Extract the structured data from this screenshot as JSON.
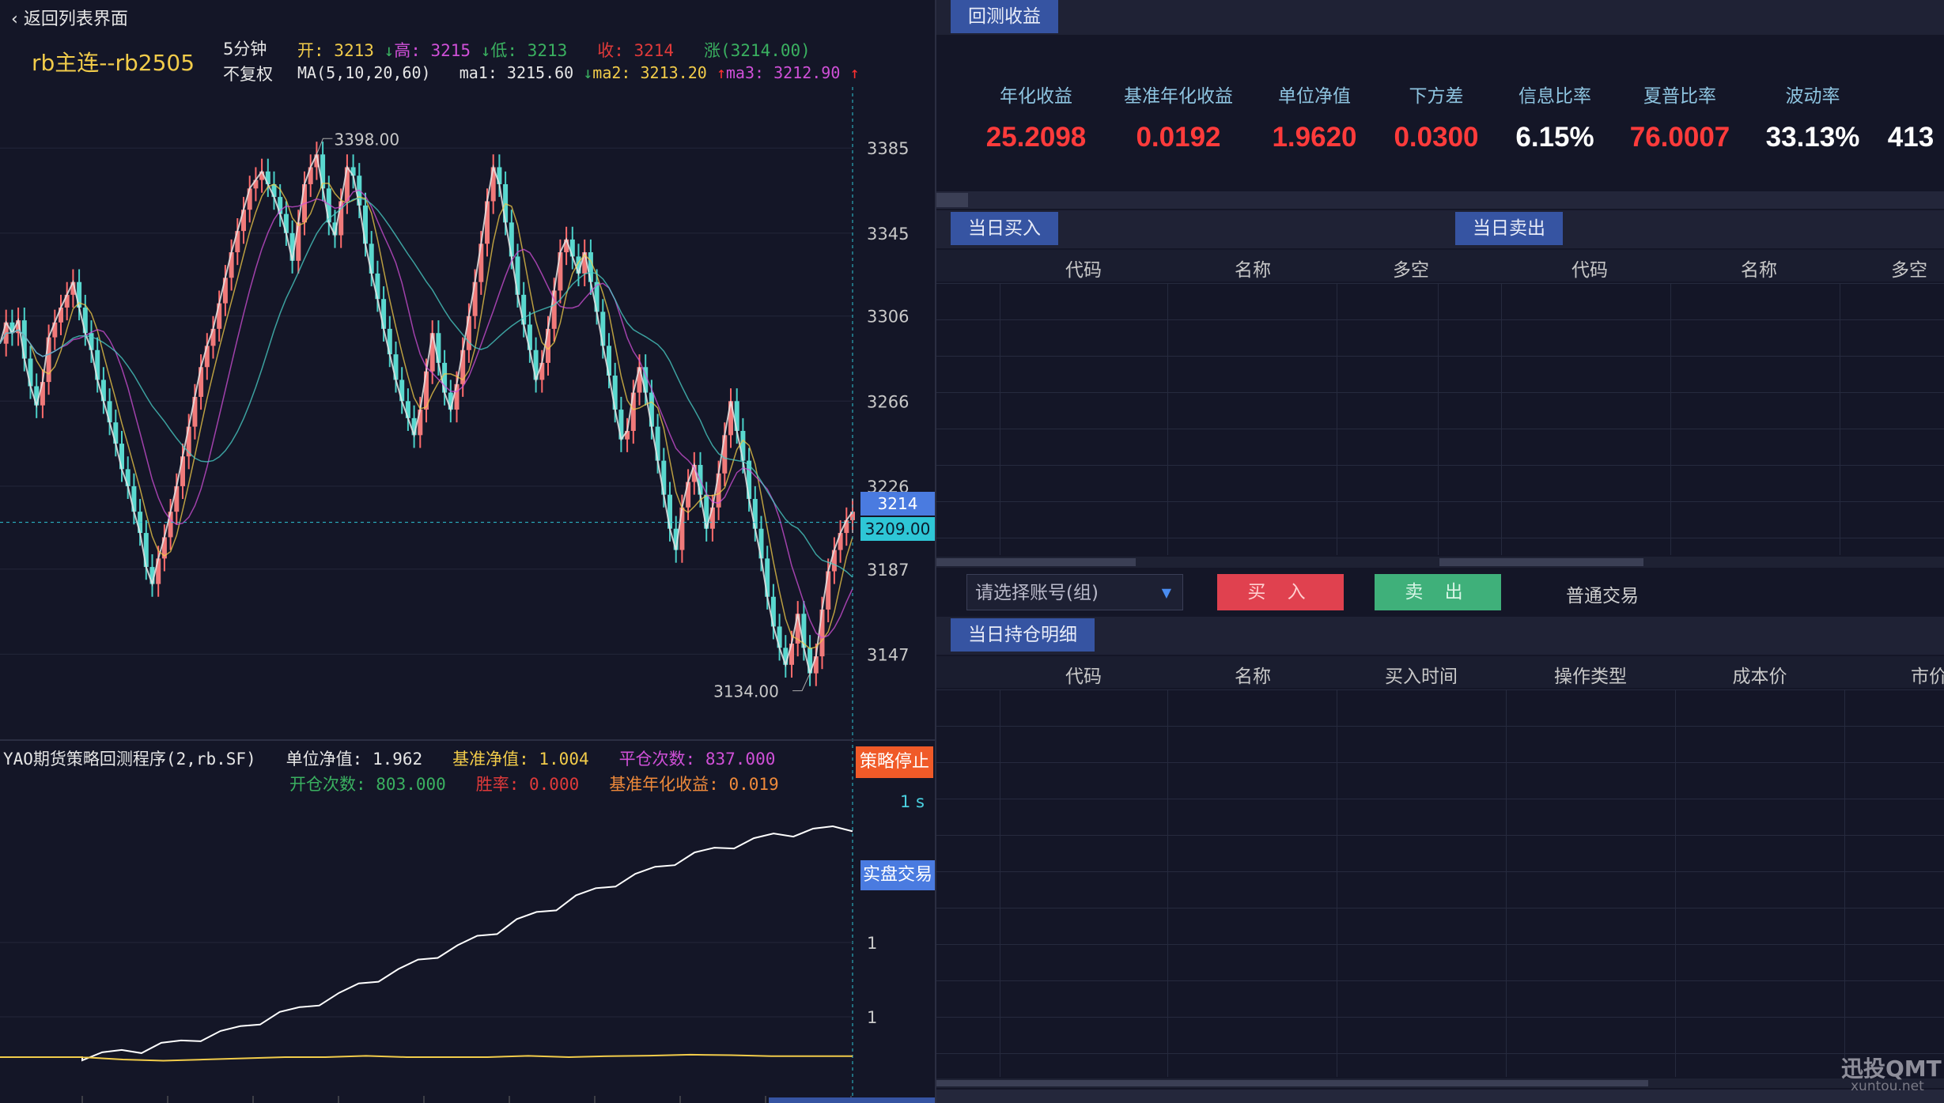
{
  "header": {
    "back_label": "返回列表界面",
    "symbol_title": "rb主连--rb2505",
    "period": "5分钟",
    "adjust": "不复权",
    "open_label": "开",
    "open_value": "3213",
    "high_label": "高",
    "high_value": "3215",
    "low_label": "低",
    "low_value": "3213",
    "close_label": "收",
    "close_value": "3214",
    "change_label": "涨(3214.00)",
    "ma_label": "MA(5,10,20,60)",
    "ma1": "ma1: 3215.60",
    "ma2": "ma2: 3213.20",
    "ma3": "ma3: 3212.90",
    "colors": {
      "title": "#f2cc4a",
      "open": "#f2cc4a",
      "high": "#d050d8",
      "low": "#3ab060",
      "close": "#e03a3a",
      "change": "#3ab060",
      "ma1": "#e6e6e6",
      "ma2": "#f2cc4a",
      "ma3": "#d050d8",
      "up": "#ff3030",
      "down": "#3ab060"
    }
  },
  "price_axis": {
    "ticks": [
      "3385",
      "3345",
      "3306",
      "3266",
      "3226",
      "3187",
      "3147"
    ],
    "current_price_tag": "3214",
    "crosshair_tag": "3209.00",
    "high_annotation": "3398.00",
    "low_annotation": "3134.00"
  },
  "chart_data": {
    "type": "line",
    "series": [
      {
        "name": "price",
        "values": [
          3293,
          3303,
          3298,
          3304,
          3286,
          3273,
          3264,
          3275,
          3296,
          3303,
          3310,
          3316,
          3322,
          3310,
          3298,
          3290,
          3276,
          3266,
          3256,
          3246,
          3234,
          3226,
          3214,
          3204,
          3188,
          3180,
          3192,
          3202,
          3214,
          3226,
          3240,
          3254,
          3268,
          3282,
          3292,
          3300,
          3312,
          3324,
          3336,
          3346,
          3356,
          3366,
          3370,
          3374,
          3368,
          3362,
          3354,
          3345,
          3332,
          3350,
          3368,
          3376,
          3382,
          3366,
          3350,
          3344,
          3360,
          3376,
          3372,
          3358,
          3340,
          3326,
          3314,
          3300,
          3288,
          3276,
          3266,
          3258,
          3250,
          3262,
          3280,
          3298,
          3284,
          3270,
          3262,
          3274,
          3290,
          3306,
          3322,
          3340,
          3360,
          3376,
          3368,
          3350,
          3334,
          3316,
          3302,
          3290,
          3276,
          3284,
          3300,
          3318,
          3336,
          3342,
          3334,
          3326,
          3336,
          3322,
          3308,
          3292,
          3278,
          3262,
          3248,
          3252,
          3270,
          3282,
          3270,
          3254,
          3238,
          3222,
          3206,
          3196,
          3216,
          3228,
          3236,
          3222,
          3206,
          3216,
          3232,
          3250,
          3266,
          3252,
          3238,
          3220,
          3206,
          3192,
          3174,
          3160,
          3150,
          3142,
          3152,
          3166,
          3150,
          3138,
          3146,
          3168,
          3186,
          3196,
          3204,
          3210,
          3214
        ]
      }
    ],
    "ylim": [
      3120,
      3410
    ],
    "x_tick_count": 11
  },
  "indicator": {
    "name": "YAO期货策略回测程序(2,rb.SF)",
    "nav_label": "单位净值: 1.962",
    "bench_nav_label": "基准净值: 1.004",
    "close_count_label": "平仓次数: 837.000",
    "open_count_label": "开仓次数: 803.000",
    "win_rate_label": "胜率: 0.000",
    "bench_annual_label": "基准年化收益: 0.019",
    "ticks": [
      "1",
      "1"
    ],
    "timer": "1 s",
    "stop_label": "策略停止",
    "live_label": "实盘交易",
    "nav_series": [
      1.0,
      1.01,
      1.02,
      1.03,
      1.05,
      1.06,
      1.08,
      1.1,
      1.12,
      1.15,
      1.18,
      1.2,
      1.23,
      1.26,
      1.3,
      1.33,
      1.36,
      1.4,
      1.43,
      1.46,
      1.5,
      1.53,
      1.57,
      1.6,
      1.63,
      1.67,
      1.7,
      1.73,
      1.76,
      1.79,
      1.82,
      1.85,
      1.87,
      1.89,
      1.91,
      1.93,
      1.94,
      1.95,
      1.96,
      1.962
    ],
    "bench_series": [
      1.0,
      0.99,
      0.985,
      0.99,
      0.995,
      1.0,
      1.0,
      1.005,
      1.0,
      1.0,
      1.0,
      1.005,
      1.0,
      1.004,
      1.006,
      1.01,
      1.008,
      1.004,
      1.004,
      1.004
    ]
  },
  "backtest": {
    "tab": "回测收益",
    "metrics": [
      {
        "label": "年化收益",
        "value": "25.2098",
        "color": "#ff3b3b"
      },
      {
        "label": "基准年化收益",
        "value": "0.0192",
        "color": "#ff3b3b"
      },
      {
        "label": "单位净值",
        "value": "1.9620",
        "color": "#ff3b3b"
      },
      {
        "label": "下方差",
        "value": "0.0300",
        "color": "#ff3b3b"
      },
      {
        "label": "信息比率",
        "value": "6.15%",
        "color": "#ffffff"
      },
      {
        "label": "夏普比率",
        "value": "76.0007",
        "color": "#ff3b3b"
      },
      {
        "label": "波动率",
        "value": "33.13%",
        "color": "#ffffff"
      },
      {
        "label": "",
        "value": "413",
        "color": "#ffffff"
      }
    ]
  },
  "buy_today": {
    "tab": "当日买入",
    "columns": [
      "代码",
      "名称",
      "多空"
    ]
  },
  "sell_today": {
    "tab": "当日卖出",
    "columns": [
      "代码",
      "名称",
      "多空"
    ]
  },
  "trade_bar": {
    "account_placeholder": "请选择账号(组)",
    "buy_label": "买 入",
    "sell_label": "卖 出",
    "mode_label": "普通交易"
  },
  "positions": {
    "tab": "当日持仓明细",
    "columns": [
      "代码",
      "名称",
      "买入时间",
      "操作类型",
      "成本价",
      "市价"
    ]
  },
  "watermark": {
    "main": "迅投QMT",
    "sub": "xuntou.net"
  }
}
